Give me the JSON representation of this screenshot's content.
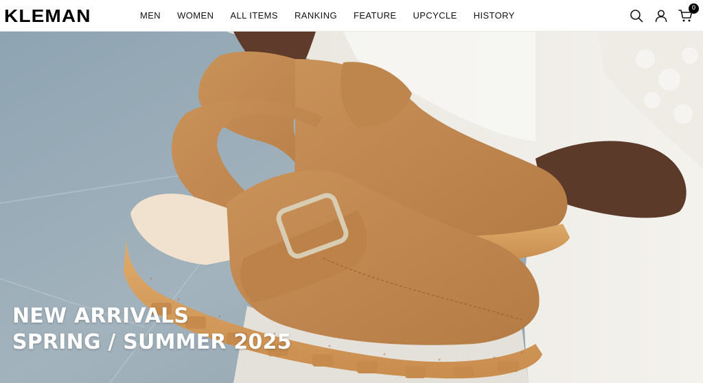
{
  "brand": {
    "name": "KLEMAN"
  },
  "nav": {
    "items": [
      {
        "label": "MEN"
      },
      {
        "label": "WOMEN"
      },
      {
        "label": "ALL ITEMS"
      },
      {
        "label": "RANKING"
      },
      {
        "label": "FEATURE"
      },
      {
        "label": "UPCYCLE"
      },
      {
        "label": "HISTORY"
      }
    ]
  },
  "header_icons": {
    "search": "search-icon",
    "account": "user-icon",
    "cart": "cart-icon",
    "cart_count": "0"
  },
  "hero": {
    "line1": "NEW ARRIVALS",
    "line2": "SPRING / SUMMER 2025"
  },
  "colors": {
    "header_bg": "#ffffff",
    "text": "#111111",
    "shoe_suede": "#c48a52",
    "sole_crepe": "#d9a463",
    "background_tile": "#9aaeb9",
    "sweater": "#f1efe9"
  }
}
